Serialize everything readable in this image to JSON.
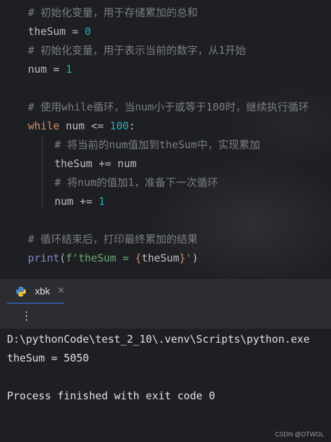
{
  "editor": {
    "comment1": "# 初始化变量，用于存储累加的总和",
    "l2_var": "theSum",
    "l2_op": " = ",
    "l2_num": "0",
    "comment3": "# 初始化变量，用于表示当前的数字，从1开始",
    "l4_var": "num",
    "l4_op": " = ",
    "l4_num": "1",
    "comment6": "# 使用while循环，当num小于或等于100时，继续执行循环",
    "l7_kw": "while",
    "l7_mid": " num <= ",
    "l7_num": "100",
    "l7_end": ":",
    "comment8": "# 将当前的num值加到theSum中，实现累加",
    "l9_code": "theSum += num",
    "comment10": "# 将num的值加1，准备下一次循环",
    "l11_code": "num += ",
    "l11_num": "1",
    "comment13": "# 循环结束后，打印最终累加的结果",
    "l14_fn": "print",
    "l14_open": "(",
    "l14_str1": "f'theSum = ",
    "l14_brace_open": "{",
    "l14_var": "theSum",
    "l14_brace_close": "}",
    "l14_str2": "'",
    "l14_close": ")"
  },
  "run_panel": {
    "tab_label": "xbk",
    "tab_close": "×",
    "tab_icon": "python-icon",
    "more_icon": "⋮"
  },
  "console": {
    "line1": "D:\\pythonCode\\test_2_10\\.venv\\Scripts\\python.exe",
    "line2": "theSum = 5050",
    "line3": "Process finished with exit code 0"
  },
  "watermark": "CSDN @OTWOL",
  "colors": {
    "keyword": "#cf8e6d",
    "number": "#2aacb8",
    "comment": "#7a7e85",
    "builtin": "#8888c6",
    "string": "#6aab73",
    "accent": "#3574f0"
  }
}
